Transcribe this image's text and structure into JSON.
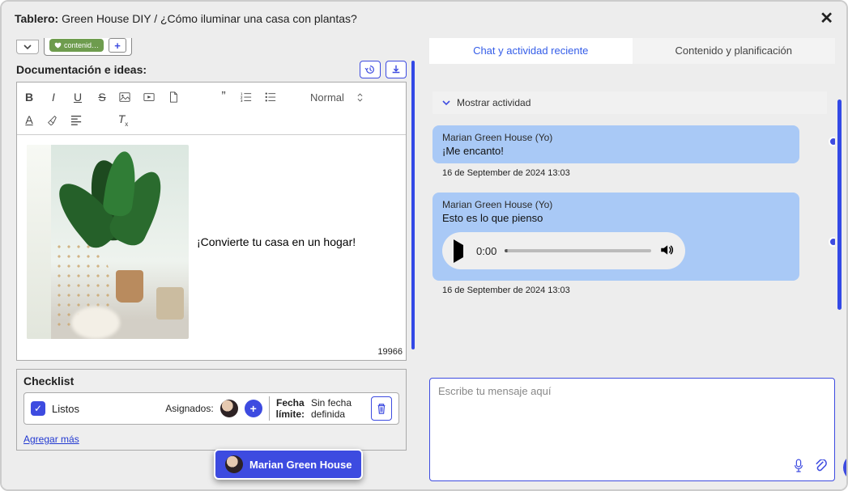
{
  "header": {
    "label_prefix": "Tablero:",
    "title": " Green House DIY / ¿Cómo iluminar una casa con plantas?"
  },
  "left": {
    "chip_label": "contenid…",
    "section_title": "Documentación e ideas:",
    "format_select": "Normal",
    "char_count": "19966",
    "editor_text": "¡Convierte tu casa en un hogar!",
    "checklist_title": "Checklist",
    "checklist_item": "Listos",
    "assigned_label": "Asignados:",
    "due_label_1": "Fecha",
    "due_label_2": "límite:",
    "due_value_1": "Sin fecha",
    "due_value_2": "definida",
    "add_more": "Agregar más",
    "tooltip_name": "Marian Green House"
  },
  "right": {
    "tab_chat": "Chat y actividad reciente",
    "tab_plan": "Contenido y planificación",
    "show_activity": "Mostrar actividad",
    "msg1_sender": "Marian Green House (Yo)",
    "msg1_body": "¡Me encanto!",
    "msg1_time": "16 de September de 2024 13:03",
    "msg2_sender": "Marian Green House (Yo)",
    "msg2_body": "Esto es lo que pienso",
    "audio_time": "0:00",
    "msg2_time": "16 de September de 2024 13:03",
    "composer_placeholder": "Escribe tu mensaje aquí"
  }
}
